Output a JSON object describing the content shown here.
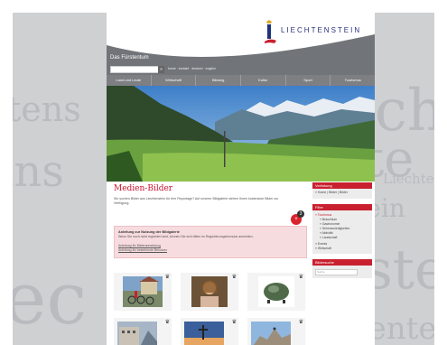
{
  "brand": {
    "name": "LIECHTENSTEIN"
  },
  "header": {
    "site_title": "Das Fürstentum",
    "search_placeholder": "",
    "search_button": "»",
    "lang_links": "home · kontakt · deutsch · english"
  },
  "nav": [
    "Land und Leute",
    "Wirtschaft",
    "Bildung",
    "Kultur",
    "Sport",
    "Tourismus"
  ],
  "background_words": [
    "tens",
    "Liechtenstein",
    "ins",
    "Liechten",
    "ste",
    "tein",
    "ec",
    "ste",
    "tenten"
  ],
  "content": {
    "title": "Medien-Bilder",
    "intro": "Sie suchen Bilder aus Liechtenstein für Ihre Reportage? Auf unserer Bildgalerie stehen Ihnen kostenlose Bilder zur Verfügung.",
    "badge": "+",
    "badge2": "3",
    "notice": {
      "title": "Anleitung zur Nutzung der Bildgalerie",
      "text": "Wenn Sie noch nicht registriert sind, können Sie sich bitten im Registrierungsformular anmelden.",
      "link1": "Anleitung für Bilderanmeldung",
      "link2": "Anleitung für bestehende Benutzer"
    },
    "thumbs": [
      {
        "name": "cyclists-photo"
      },
      {
        "name": "woman-portrait-photo"
      },
      {
        "name": "stone-sculpture-photo"
      },
      {
        "name": "building-photo"
      },
      {
        "name": "mountain-cross-photo"
      },
      {
        "name": "mountain-ridge-photo"
      }
    ]
  },
  "sidebar": {
    "breadcrumb_head": "Verlinkung",
    "breadcrumb_body": "» Home | Bilder | Bilder",
    "filter_head": "Filter",
    "filter": [
      {
        "label": "» Tourismus",
        "active": true,
        "sub": false
      },
      {
        "label": "» Brauchtum",
        "active": false,
        "sub": true
      },
      {
        "label": "» Gastronomie",
        "active": false,
        "sub": true
      },
      {
        "label": "» Sehenswürdigkeiten",
        "active": false,
        "sub": true
      },
      {
        "label": "» Aktivität",
        "active": false,
        "sub": true
      },
      {
        "label": "» Landschaft",
        "active": false,
        "sub": true
      },
      {
        "label": "» Events",
        "active": false,
        "sub": false
      },
      {
        "label": "» Wirtschaft",
        "active": false,
        "sub": false
      }
    ],
    "search_head": "Bildersuche",
    "search_placeholder": "Suche"
  },
  "colors": {
    "accent": "#c9202f",
    "nav": "#7d7f83",
    "header": "#6f7277"
  }
}
